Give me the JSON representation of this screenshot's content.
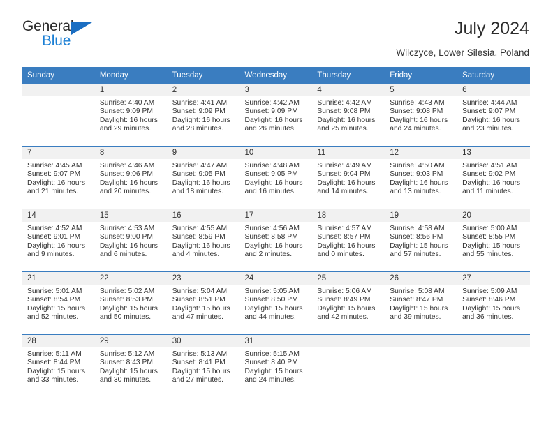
{
  "brand": {
    "name_dark": "General",
    "name_blue": "Blue",
    "accent_color": "#1b7fd4",
    "triangle_color": "#1b6ec2"
  },
  "header": {
    "title": "July 2024",
    "subtitle": "Wilczyce, Lower Silesia, Poland",
    "header_bg": "#3a7dc0",
    "daynum_bg": "#f1f1f1"
  },
  "calendar": {
    "weekday_headers": [
      "Sunday",
      "Monday",
      "Tuesday",
      "Wednesday",
      "Thursday",
      "Friday",
      "Saturday"
    ],
    "weeks": [
      [
        {
          "day": "",
          "blank": true,
          "sunrise": "",
          "sunset": "",
          "daylight1": "",
          "daylight2": ""
        },
        {
          "day": "1",
          "sunrise": "Sunrise: 4:40 AM",
          "sunset": "Sunset: 9:09 PM",
          "daylight1": "Daylight: 16 hours",
          "daylight2": "and 29 minutes."
        },
        {
          "day": "2",
          "sunrise": "Sunrise: 4:41 AM",
          "sunset": "Sunset: 9:09 PM",
          "daylight1": "Daylight: 16 hours",
          "daylight2": "and 28 minutes."
        },
        {
          "day": "3",
          "sunrise": "Sunrise: 4:42 AM",
          "sunset": "Sunset: 9:09 PM",
          "daylight1": "Daylight: 16 hours",
          "daylight2": "and 26 minutes."
        },
        {
          "day": "4",
          "sunrise": "Sunrise: 4:42 AM",
          "sunset": "Sunset: 9:08 PM",
          "daylight1": "Daylight: 16 hours",
          "daylight2": "and 25 minutes."
        },
        {
          "day": "5",
          "sunrise": "Sunrise: 4:43 AM",
          "sunset": "Sunset: 9:08 PM",
          "daylight1": "Daylight: 16 hours",
          "daylight2": "and 24 minutes."
        },
        {
          "day": "6",
          "sunrise": "Sunrise: 4:44 AM",
          "sunset": "Sunset: 9:07 PM",
          "daylight1": "Daylight: 16 hours",
          "daylight2": "and 23 minutes."
        }
      ],
      [
        {
          "day": "7",
          "sunrise": "Sunrise: 4:45 AM",
          "sunset": "Sunset: 9:07 PM",
          "daylight1": "Daylight: 16 hours",
          "daylight2": "and 21 minutes."
        },
        {
          "day": "8",
          "sunrise": "Sunrise: 4:46 AM",
          "sunset": "Sunset: 9:06 PM",
          "daylight1": "Daylight: 16 hours",
          "daylight2": "and 20 minutes."
        },
        {
          "day": "9",
          "sunrise": "Sunrise: 4:47 AM",
          "sunset": "Sunset: 9:05 PM",
          "daylight1": "Daylight: 16 hours",
          "daylight2": "and 18 minutes."
        },
        {
          "day": "10",
          "sunrise": "Sunrise: 4:48 AM",
          "sunset": "Sunset: 9:05 PM",
          "daylight1": "Daylight: 16 hours",
          "daylight2": "and 16 minutes."
        },
        {
          "day": "11",
          "sunrise": "Sunrise: 4:49 AM",
          "sunset": "Sunset: 9:04 PM",
          "daylight1": "Daylight: 16 hours",
          "daylight2": "and 14 minutes."
        },
        {
          "day": "12",
          "sunrise": "Sunrise: 4:50 AM",
          "sunset": "Sunset: 9:03 PM",
          "daylight1": "Daylight: 16 hours",
          "daylight2": "and 13 minutes."
        },
        {
          "day": "13",
          "sunrise": "Sunrise: 4:51 AM",
          "sunset": "Sunset: 9:02 PM",
          "daylight1": "Daylight: 16 hours",
          "daylight2": "and 11 minutes."
        }
      ],
      [
        {
          "day": "14",
          "sunrise": "Sunrise: 4:52 AM",
          "sunset": "Sunset: 9:01 PM",
          "daylight1": "Daylight: 16 hours",
          "daylight2": "and 9 minutes."
        },
        {
          "day": "15",
          "sunrise": "Sunrise: 4:53 AM",
          "sunset": "Sunset: 9:00 PM",
          "daylight1": "Daylight: 16 hours",
          "daylight2": "and 6 minutes."
        },
        {
          "day": "16",
          "sunrise": "Sunrise: 4:55 AM",
          "sunset": "Sunset: 8:59 PM",
          "daylight1": "Daylight: 16 hours",
          "daylight2": "and 4 minutes."
        },
        {
          "day": "17",
          "sunrise": "Sunrise: 4:56 AM",
          "sunset": "Sunset: 8:58 PM",
          "daylight1": "Daylight: 16 hours",
          "daylight2": "and 2 minutes."
        },
        {
          "day": "18",
          "sunrise": "Sunrise: 4:57 AM",
          "sunset": "Sunset: 8:57 PM",
          "daylight1": "Daylight: 16 hours",
          "daylight2": "and 0 minutes."
        },
        {
          "day": "19",
          "sunrise": "Sunrise: 4:58 AM",
          "sunset": "Sunset: 8:56 PM",
          "daylight1": "Daylight: 15 hours",
          "daylight2": "and 57 minutes."
        },
        {
          "day": "20",
          "sunrise": "Sunrise: 5:00 AM",
          "sunset": "Sunset: 8:55 PM",
          "daylight1": "Daylight: 15 hours",
          "daylight2": "and 55 minutes."
        }
      ],
      [
        {
          "day": "21",
          "sunrise": "Sunrise: 5:01 AM",
          "sunset": "Sunset: 8:54 PM",
          "daylight1": "Daylight: 15 hours",
          "daylight2": "and 52 minutes."
        },
        {
          "day": "22",
          "sunrise": "Sunrise: 5:02 AM",
          "sunset": "Sunset: 8:53 PM",
          "daylight1": "Daylight: 15 hours",
          "daylight2": "and 50 minutes."
        },
        {
          "day": "23",
          "sunrise": "Sunrise: 5:04 AM",
          "sunset": "Sunset: 8:51 PM",
          "daylight1": "Daylight: 15 hours",
          "daylight2": "and 47 minutes."
        },
        {
          "day": "24",
          "sunrise": "Sunrise: 5:05 AM",
          "sunset": "Sunset: 8:50 PM",
          "daylight1": "Daylight: 15 hours",
          "daylight2": "and 44 minutes."
        },
        {
          "day": "25",
          "sunrise": "Sunrise: 5:06 AM",
          "sunset": "Sunset: 8:49 PM",
          "daylight1": "Daylight: 15 hours",
          "daylight2": "and 42 minutes."
        },
        {
          "day": "26",
          "sunrise": "Sunrise: 5:08 AM",
          "sunset": "Sunset: 8:47 PM",
          "daylight1": "Daylight: 15 hours",
          "daylight2": "and 39 minutes."
        },
        {
          "day": "27",
          "sunrise": "Sunrise: 5:09 AM",
          "sunset": "Sunset: 8:46 PM",
          "daylight1": "Daylight: 15 hours",
          "daylight2": "and 36 minutes."
        }
      ],
      [
        {
          "day": "28",
          "sunrise": "Sunrise: 5:11 AM",
          "sunset": "Sunset: 8:44 PM",
          "daylight1": "Daylight: 15 hours",
          "daylight2": "and 33 minutes."
        },
        {
          "day": "29",
          "sunrise": "Sunrise: 5:12 AM",
          "sunset": "Sunset: 8:43 PM",
          "daylight1": "Daylight: 15 hours",
          "daylight2": "and 30 minutes."
        },
        {
          "day": "30",
          "sunrise": "Sunrise: 5:13 AM",
          "sunset": "Sunset: 8:41 PM",
          "daylight1": "Daylight: 15 hours",
          "daylight2": "and 27 minutes."
        },
        {
          "day": "31",
          "sunrise": "Sunrise: 5:15 AM",
          "sunset": "Sunset: 8:40 PM",
          "daylight1": "Daylight: 15 hours",
          "daylight2": "and 24 minutes."
        },
        {
          "day": "",
          "blank": true,
          "sunrise": "",
          "sunset": "",
          "daylight1": "",
          "daylight2": ""
        },
        {
          "day": "",
          "blank": true,
          "sunrise": "",
          "sunset": "",
          "daylight1": "",
          "daylight2": ""
        },
        {
          "day": "",
          "blank": true,
          "sunrise": "",
          "sunset": "",
          "daylight1": "",
          "daylight2": ""
        }
      ]
    ]
  }
}
